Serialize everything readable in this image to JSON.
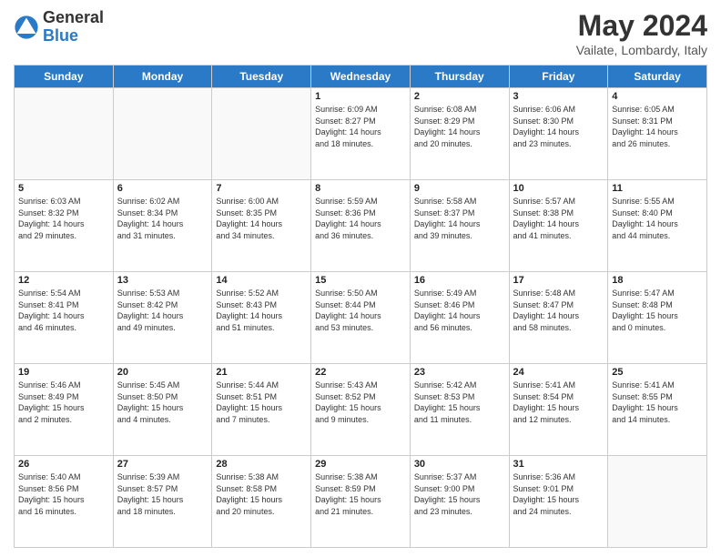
{
  "logo": {
    "general": "General",
    "blue": "Blue"
  },
  "title": "May 2024",
  "location": "Vailate, Lombardy, Italy",
  "headers": [
    "Sunday",
    "Monday",
    "Tuesday",
    "Wednesday",
    "Thursday",
    "Friday",
    "Saturday"
  ],
  "weeks": [
    [
      {
        "num": "",
        "info": ""
      },
      {
        "num": "",
        "info": ""
      },
      {
        "num": "",
        "info": ""
      },
      {
        "num": "1",
        "info": "Sunrise: 6:09 AM\nSunset: 8:27 PM\nDaylight: 14 hours\nand 18 minutes."
      },
      {
        "num": "2",
        "info": "Sunrise: 6:08 AM\nSunset: 8:29 PM\nDaylight: 14 hours\nand 20 minutes."
      },
      {
        "num": "3",
        "info": "Sunrise: 6:06 AM\nSunset: 8:30 PM\nDaylight: 14 hours\nand 23 minutes."
      },
      {
        "num": "4",
        "info": "Sunrise: 6:05 AM\nSunset: 8:31 PM\nDaylight: 14 hours\nand 26 minutes."
      }
    ],
    [
      {
        "num": "5",
        "info": "Sunrise: 6:03 AM\nSunset: 8:32 PM\nDaylight: 14 hours\nand 29 minutes."
      },
      {
        "num": "6",
        "info": "Sunrise: 6:02 AM\nSunset: 8:34 PM\nDaylight: 14 hours\nand 31 minutes."
      },
      {
        "num": "7",
        "info": "Sunrise: 6:00 AM\nSunset: 8:35 PM\nDaylight: 14 hours\nand 34 minutes."
      },
      {
        "num": "8",
        "info": "Sunrise: 5:59 AM\nSunset: 8:36 PM\nDaylight: 14 hours\nand 36 minutes."
      },
      {
        "num": "9",
        "info": "Sunrise: 5:58 AM\nSunset: 8:37 PM\nDaylight: 14 hours\nand 39 minutes."
      },
      {
        "num": "10",
        "info": "Sunrise: 5:57 AM\nSunset: 8:38 PM\nDaylight: 14 hours\nand 41 minutes."
      },
      {
        "num": "11",
        "info": "Sunrise: 5:55 AM\nSunset: 8:40 PM\nDaylight: 14 hours\nand 44 minutes."
      }
    ],
    [
      {
        "num": "12",
        "info": "Sunrise: 5:54 AM\nSunset: 8:41 PM\nDaylight: 14 hours\nand 46 minutes."
      },
      {
        "num": "13",
        "info": "Sunrise: 5:53 AM\nSunset: 8:42 PM\nDaylight: 14 hours\nand 49 minutes."
      },
      {
        "num": "14",
        "info": "Sunrise: 5:52 AM\nSunset: 8:43 PM\nDaylight: 14 hours\nand 51 minutes."
      },
      {
        "num": "15",
        "info": "Sunrise: 5:50 AM\nSunset: 8:44 PM\nDaylight: 14 hours\nand 53 minutes."
      },
      {
        "num": "16",
        "info": "Sunrise: 5:49 AM\nSunset: 8:46 PM\nDaylight: 14 hours\nand 56 minutes."
      },
      {
        "num": "17",
        "info": "Sunrise: 5:48 AM\nSunset: 8:47 PM\nDaylight: 14 hours\nand 58 minutes."
      },
      {
        "num": "18",
        "info": "Sunrise: 5:47 AM\nSunset: 8:48 PM\nDaylight: 15 hours\nand 0 minutes."
      }
    ],
    [
      {
        "num": "19",
        "info": "Sunrise: 5:46 AM\nSunset: 8:49 PM\nDaylight: 15 hours\nand 2 minutes."
      },
      {
        "num": "20",
        "info": "Sunrise: 5:45 AM\nSunset: 8:50 PM\nDaylight: 15 hours\nand 4 minutes."
      },
      {
        "num": "21",
        "info": "Sunrise: 5:44 AM\nSunset: 8:51 PM\nDaylight: 15 hours\nand 7 minutes."
      },
      {
        "num": "22",
        "info": "Sunrise: 5:43 AM\nSunset: 8:52 PM\nDaylight: 15 hours\nand 9 minutes."
      },
      {
        "num": "23",
        "info": "Sunrise: 5:42 AM\nSunset: 8:53 PM\nDaylight: 15 hours\nand 11 minutes."
      },
      {
        "num": "24",
        "info": "Sunrise: 5:41 AM\nSunset: 8:54 PM\nDaylight: 15 hours\nand 12 minutes."
      },
      {
        "num": "25",
        "info": "Sunrise: 5:41 AM\nSunset: 8:55 PM\nDaylight: 15 hours\nand 14 minutes."
      }
    ],
    [
      {
        "num": "26",
        "info": "Sunrise: 5:40 AM\nSunset: 8:56 PM\nDaylight: 15 hours\nand 16 minutes."
      },
      {
        "num": "27",
        "info": "Sunrise: 5:39 AM\nSunset: 8:57 PM\nDaylight: 15 hours\nand 18 minutes."
      },
      {
        "num": "28",
        "info": "Sunrise: 5:38 AM\nSunset: 8:58 PM\nDaylight: 15 hours\nand 20 minutes."
      },
      {
        "num": "29",
        "info": "Sunrise: 5:38 AM\nSunset: 8:59 PM\nDaylight: 15 hours\nand 21 minutes."
      },
      {
        "num": "30",
        "info": "Sunrise: 5:37 AM\nSunset: 9:00 PM\nDaylight: 15 hours\nand 23 minutes."
      },
      {
        "num": "31",
        "info": "Sunrise: 5:36 AM\nSunset: 9:01 PM\nDaylight: 15 hours\nand 24 minutes."
      },
      {
        "num": "",
        "info": ""
      }
    ]
  ]
}
